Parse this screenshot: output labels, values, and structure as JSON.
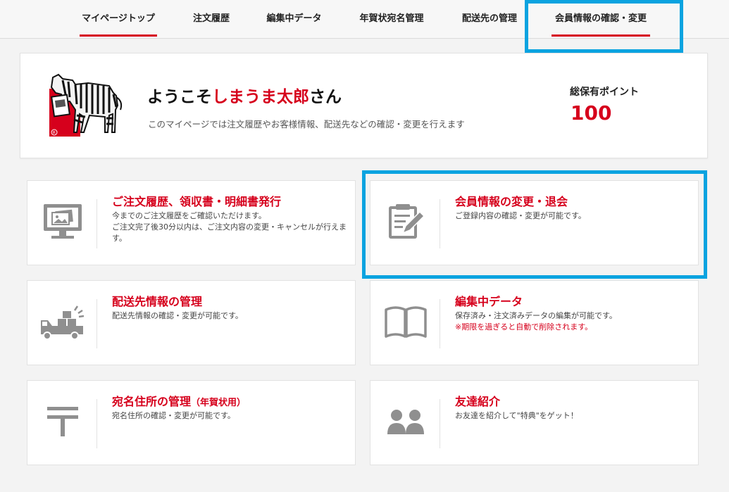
{
  "tabs": [
    {
      "label": "マイページトップ",
      "active": true
    },
    {
      "label": "注文履歴"
    },
    {
      "label": "編集中データ"
    },
    {
      "label": "年賀状宛名管理"
    },
    {
      "label": "配送先の管理"
    },
    {
      "label": "会員情報の確認・変更",
      "underlined": true
    }
  ],
  "welcome": {
    "prefix": "ようこそ",
    "name": "しまうま太郎",
    "suffix": "さん",
    "subtitle": "このマイページでは注文履歴やお客様情報、配送先などの確認・変更を行えます",
    "points_label": "総保有ポイント",
    "points_value": "100"
  },
  "cards": {
    "orders": {
      "title": "ご注文履歴、領収書・明細書発行",
      "desc1": "今までのご注文履歴をご確認いただけます。",
      "desc2": "ご注文完了後30分以内は、ご注文内容の変更・キャンセルが行えます。"
    },
    "member": {
      "title": "会員情報の変更・退会",
      "desc1": "ご登録内容の確認・変更が可能です。"
    },
    "shipping": {
      "title": "配送先情報の管理",
      "desc1": "配送先情報の確認・変更が可能です。"
    },
    "editing": {
      "title": "編集中データ",
      "desc1": "保存済み・注文済みデータの編集が可能です。",
      "note": "※期限を過ぎると自動で削除されます。"
    },
    "address": {
      "title_main": "宛名住所の管理",
      "title_sub": "（年賀状用）",
      "desc1": "宛名住所の確認・変更が可能です。"
    },
    "referral": {
      "title": "友達紹介",
      "desc1": "お友達を紹介して\"特典\"をゲット！"
    }
  },
  "colors": {
    "accent": "#d6001c",
    "highlight": "#0aa3e0",
    "icon": "#8f8f8f"
  }
}
